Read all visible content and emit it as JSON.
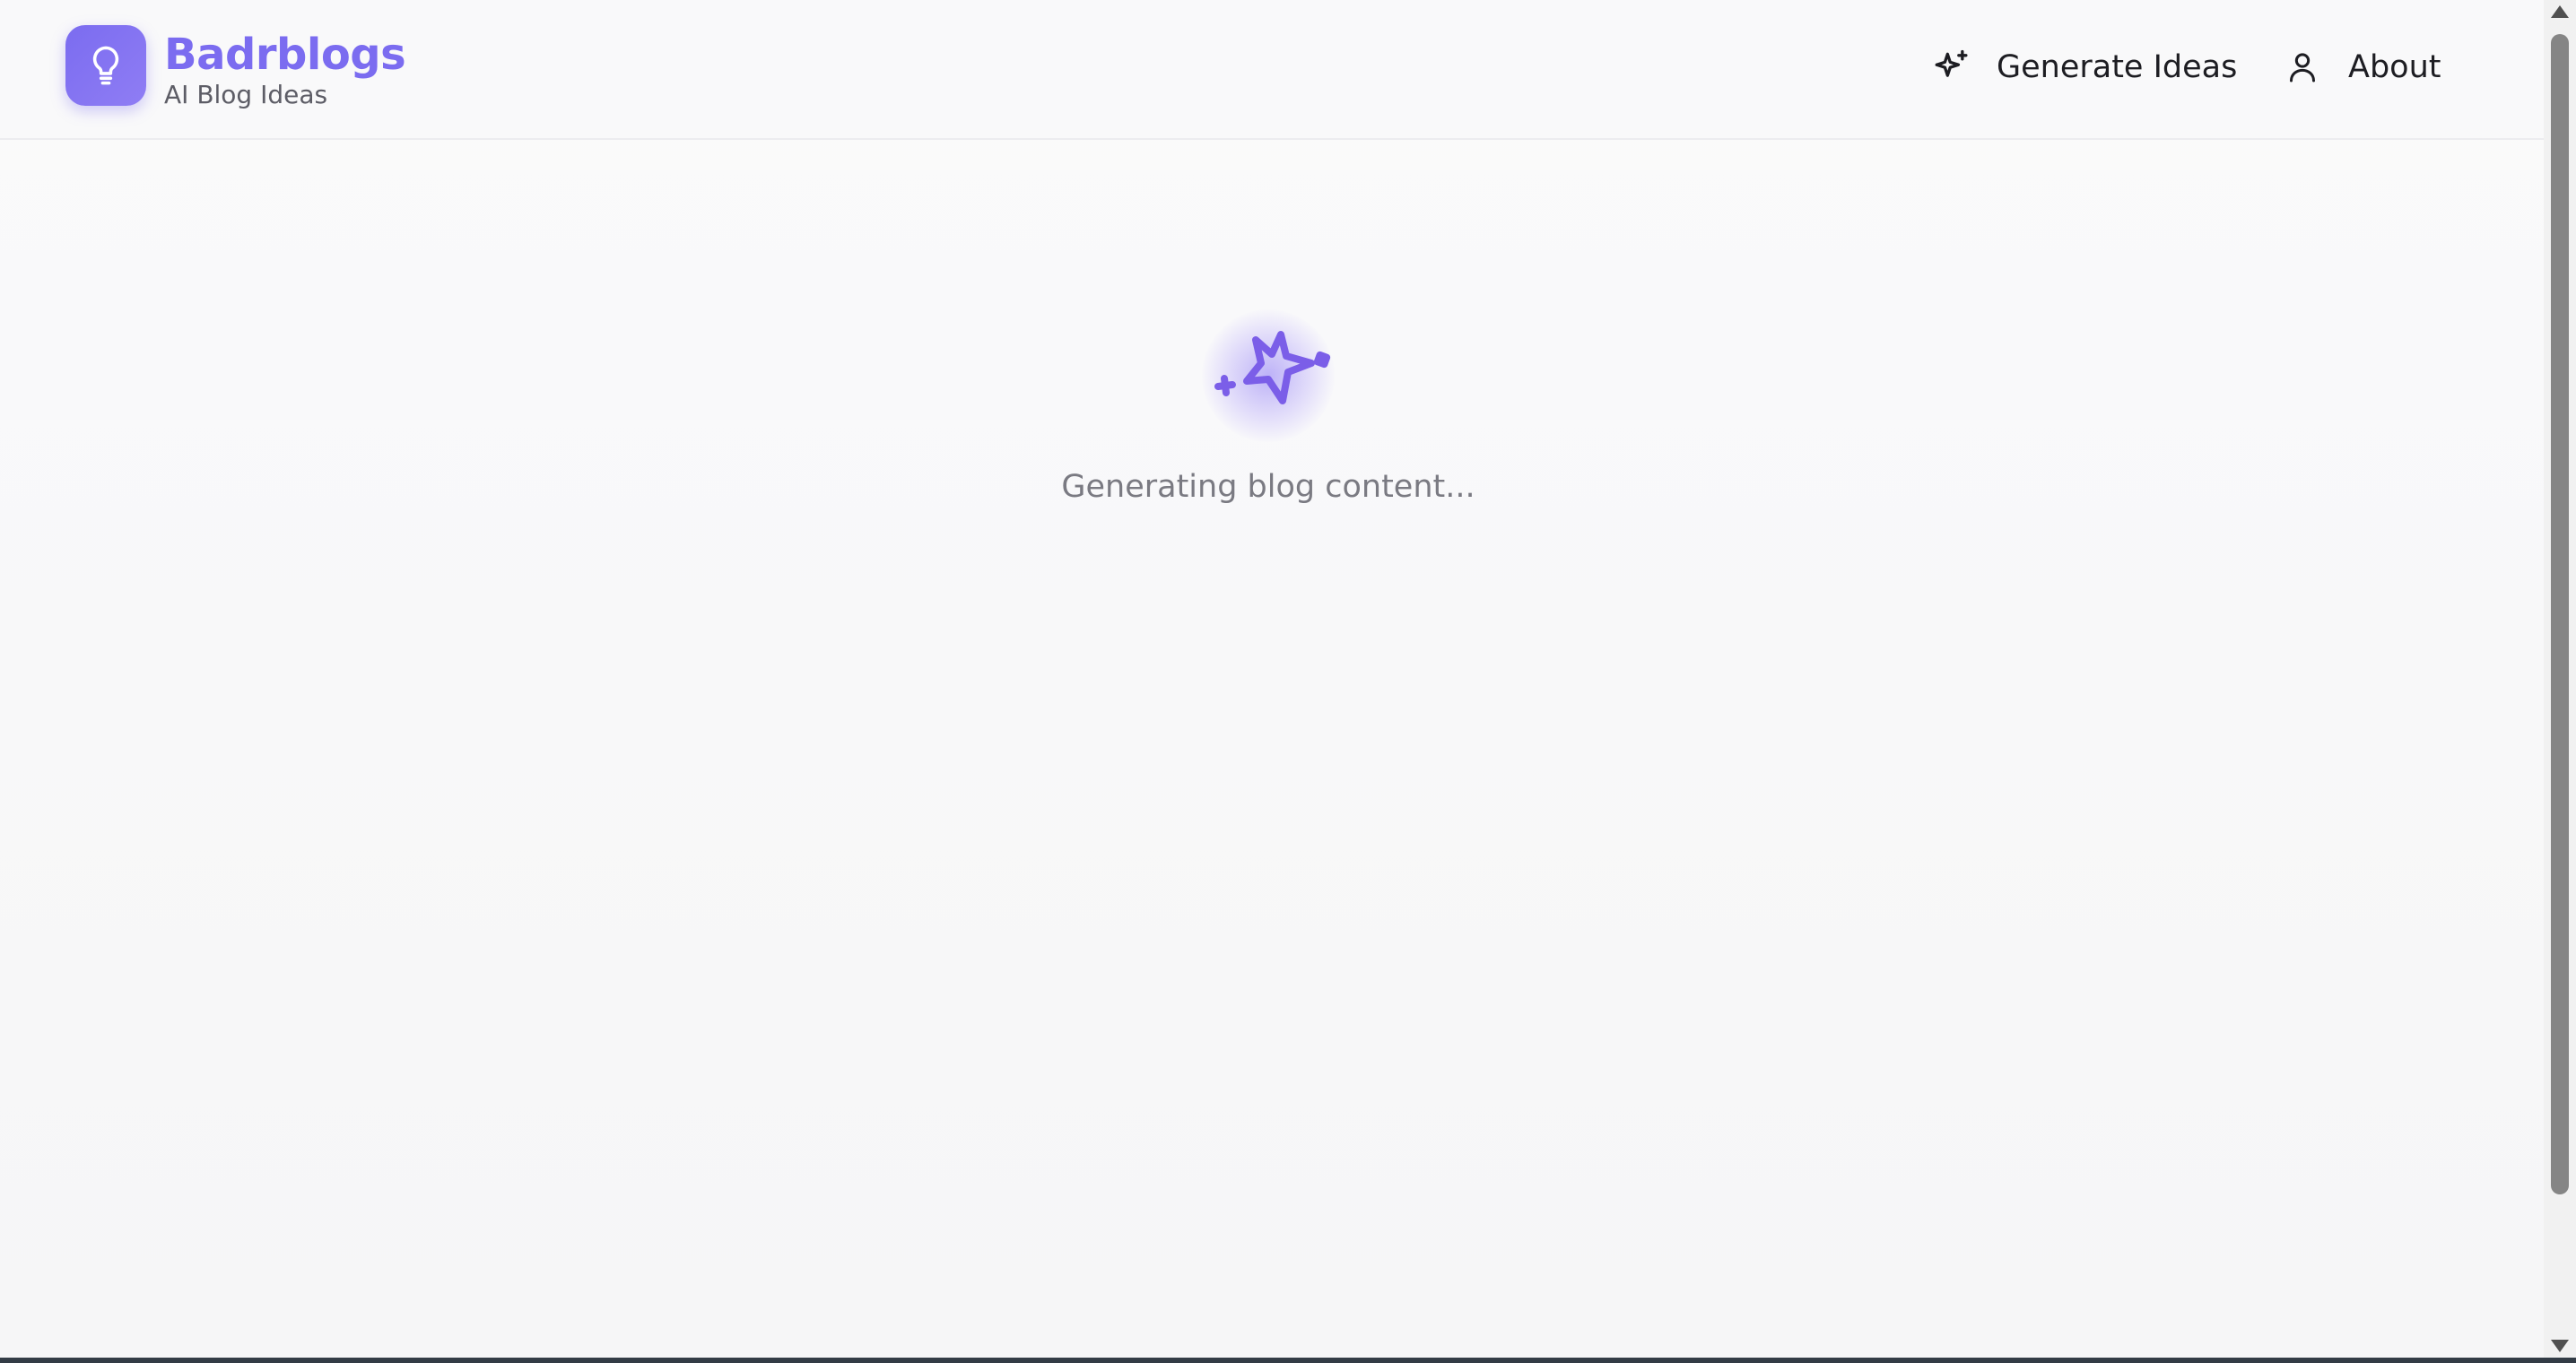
{
  "header": {
    "brand_name": "Badrblogs",
    "brand_subtitle": "AI Blog Ideas",
    "logo_icon": "lightbulb-icon",
    "nav": [
      {
        "label": "Generate Ideas",
        "icon": "sparkles-icon"
      },
      {
        "label": "About",
        "icon": "user-icon"
      }
    ]
  },
  "main": {
    "loading_icon": "sparkles-icon",
    "loading_text": "Generating blog content..."
  },
  "colors": {
    "accent": "#7b6cf0",
    "text_primary": "#1d1d22",
    "text_muted": "#7a7a82"
  }
}
